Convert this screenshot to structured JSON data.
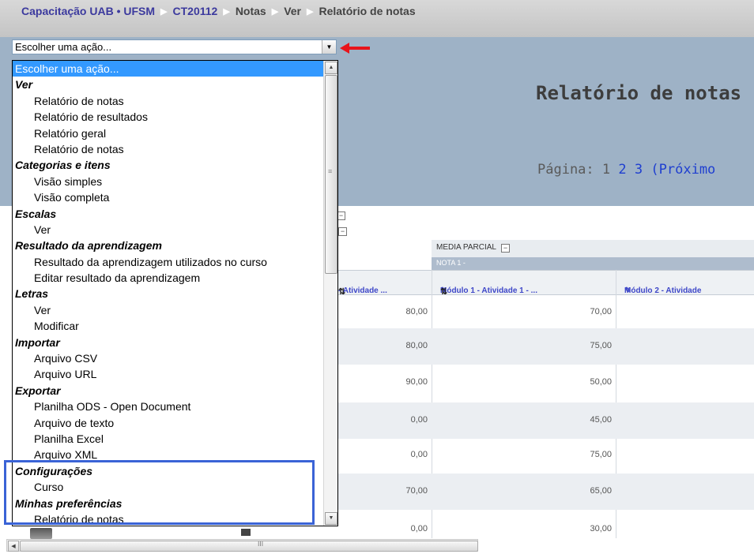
{
  "breadcrumb": {
    "items": [
      "Capacitação UAB • UFSM",
      "CT20112",
      "Notas",
      "Ver",
      "Relatório de notas"
    ]
  },
  "page": {
    "title": "Relatório de notas",
    "paging_label": "Página:",
    "pages": [
      "1",
      "2",
      "3"
    ],
    "next_label": "(Próximo"
  },
  "action_select": {
    "value": "Escolher uma ação...",
    "options": [
      {
        "label": "Escolher uma ação...",
        "kind": "selected"
      },
      {
        "label": "Ver",
        "kind": "group"
      },
      {
        "label": "Relatório de notas",
        "kind": "item"
      },
      {
        "label": "Relatório de resultados",
        "kind": "item"
      },
      {
        "label": "Relatório geral",
        "kind": "item"
      },
      {
        "label": "Relatório de notas",
        "kind": "item"
      },
      {
        "label": "Categorias e itens",
        "kind": "group"
      },
      {
        "label": "Visão simples",
        "kind": "item"
      },
      {
        "label": "Visão completa",
        "kind": "item"
      },
      {
        "label": "Escalas",
        "kind": "group"
      },
      {
        "label": "Ver",
        "kind": "item"
      },
      {
        "label": "Resultado da aprendizagem",
        "kind": "group"
      },
      {
        "label": "Resultado da aprendizagem utilizados no curso",
        "kind": "item"
      },
      {
        "label": "Editar resultado da aprendizagem",
        "kind": "item"
      },
      {
        "label": "Letras",
        "kind": "group"
      },
      {
        "label": "Ver",
        "kind": "item"
      },
      {
        "label": "Modificar",
        "kind": "item"
      },
      {
        "label": "Importar",
        "kind": "group"
      },
      {
        "label": "Arquivo CSV",
        "kind": "item"
      },
      {
        "label": "Arquivo URL",
        "kind": "item"
      },
      {
        "label": "Exportar",
        "kind": "group"
      },
      {
        "label": "Planilha ODS - Open Document",
        "kind": "item"
      },
      {
        "label": "Arquivo de texto",
        "kind": "item"
      },
      {
        "label": "Planilha Excel",
        "kind": "item"
      },
      {
        "label": "Arquivo XML",
        "kind": "item"
      },
      {
        "label": "Configurações",
        "kind": "group"
      },
      {
        "label": "Curso",
        "kind": "item"
      },
      {
        "label": "Minhas preferências",
        "kind": "group"
      },
      {
        "label": "Relatório de notas",
        "kind": "item"
      }
    ]
  },
  "grades": {
    "category_header": "MEDIA PARCIAL",
    "subcategory_header": "NOTA 1 -",
    "columns": [
      "- Atividade ...",
      "Módulo 1 - Atividade 1 - ...",
      "Módulo 2 - Atividade"
    ],
    "rows": [
      [
        "80,00",
        "70,00"
      ],
      [
        "80,00",
        "75,00"
      ],
      [
        "90,00",
        "50,00"
      ],
      [
        "0,00",
        "45,00"
      ],
      [
        "0,00",
        "75,00"
      ],
      [
        "70,00",
        "65,00"
      ],
      [
        "0,00",
        "30,00"
      ]
    ]
  },
  "colors": {
    "header_bg": "#9eb2c6",
    "link": "#3c3a9e",
    "selected_option": "#3399ff",
    "highlight_box": "#3a63d6",
    "pointer_arrow": "#e8141b"
  }
}
